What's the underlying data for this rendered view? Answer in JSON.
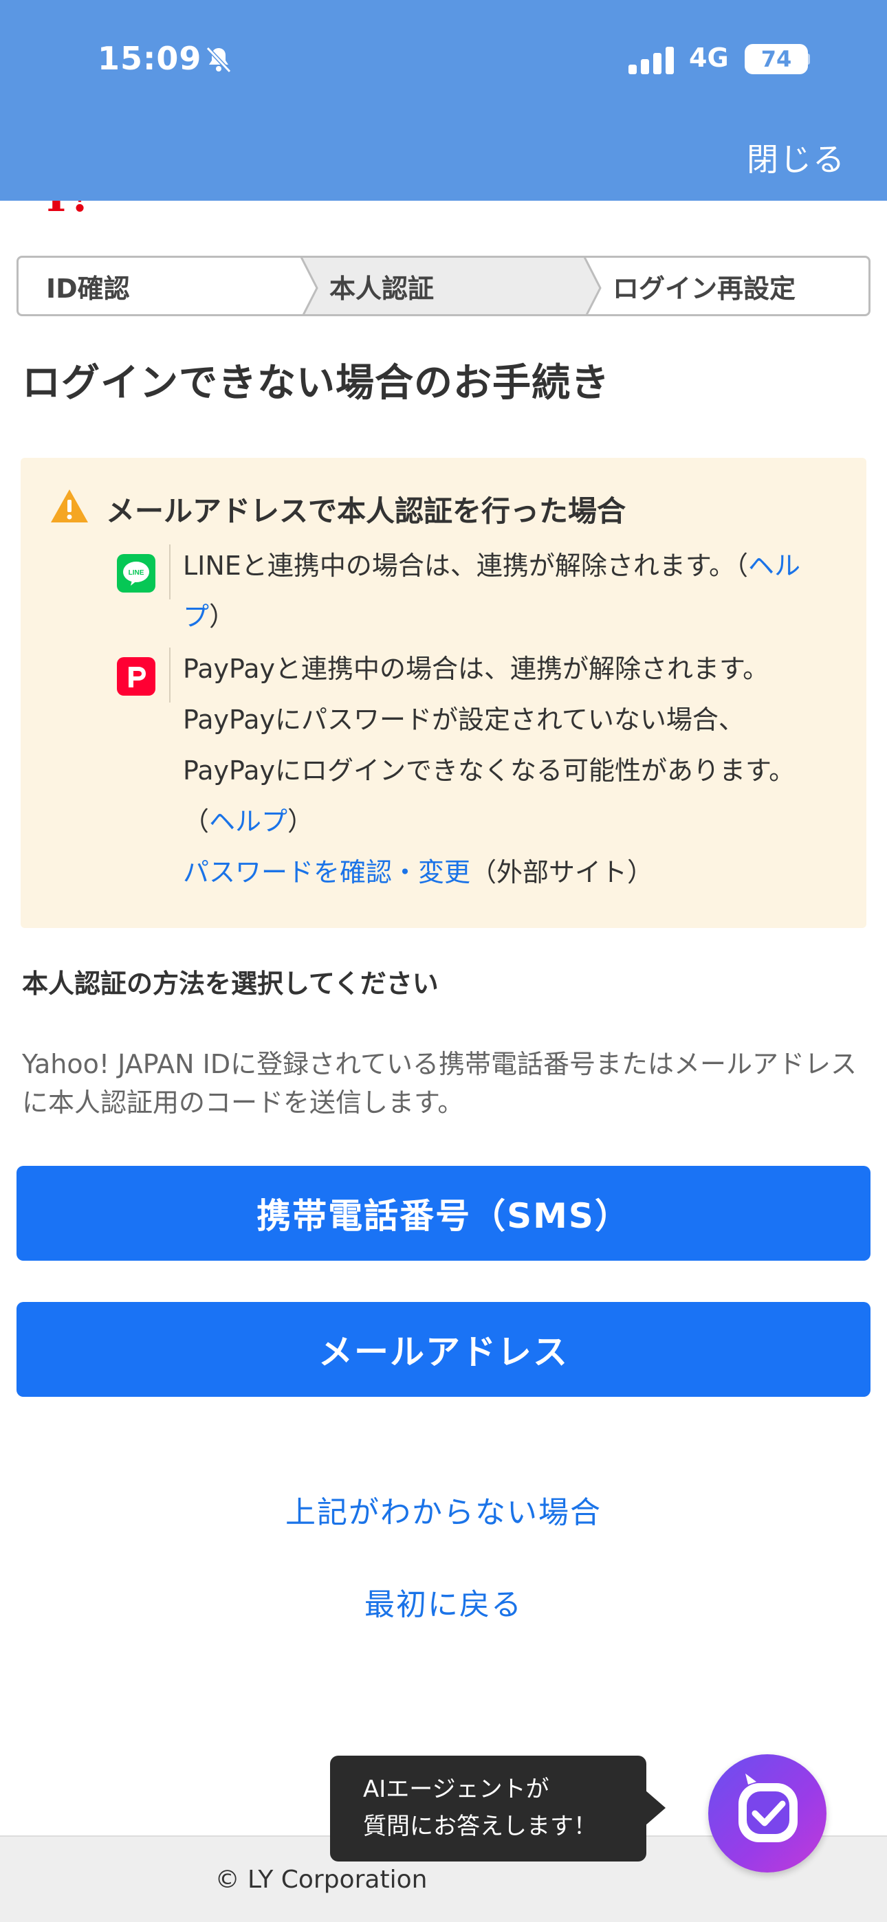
{
  "status_bar": {
    "time": "15:09",
    "network": "4G",
    "battery": "74",
    "icons": [
      "bell-muted-icon",
      "signal-icon",
      "battery-icon"
    ]
  },
  "header": {
    "close_label": "閉じる"
  },
  "steps": [
    {
      "label": "ID確認",
      "active": false
    },
    {
      "label": "本人認証",
      "active": true
    },
    {
      "label": "ログイン再設定",
      "active": false
    }
  ],
  "page_title": "ログインできない場合のお手続き",
  "warning": {
    "title": "メールアドレスで本人認証を行った場合",
    "line_text": "LINEと連携中の場合は、連携が解除されます。（",
    "line_help": "ヘルプ",
    "line_close": "）",
    "paypay_line1": "PayPayと連携中の場合は、連携が解除されます。",
    "paypay_line2": "PayPayにパスワードが設定されていない場合、",
    "paypay_line3": "PayPayにログインできなくなる可能性があります。",
    "paypay_open": "（",
    "paypay_help": "ヘルプ",
    "paypay_close": "）",
    "password_link": "パスワードを確認・変更",
    "external_note": "（外部サイト）"
  },
  "method": {
    "label": "本人認証の方法を選択してください",
    "description": "Yahoo! JAPAN IDに登録されている携帯電話番号またはメールアドレスに本人認証用のコードを送信します。",
    "sms_button": "携帯電話番号（SMS）",
    "email_button": "メールアドレス"
  },
  "links": {
    "unknown": "上記がわからない場合",
    "back": "最初に戻る"
  },
  "ai_agent": {
    "tooltip_line1": "AIエージェントが",
    "tooltip_line2": "質問にお答えします！"
  },
  "footer": {
    "copyright": "© LY Corporation"
  },
  "colors": {
    "header": "#5b97e3",
    "primary": "#1a73f5",
    "link": "#1a73e8",
    "warning_bg": "#fdf4e2",
    "line_green": "#06c755",
    "paypay_red": "#ff0033"
  }
}
